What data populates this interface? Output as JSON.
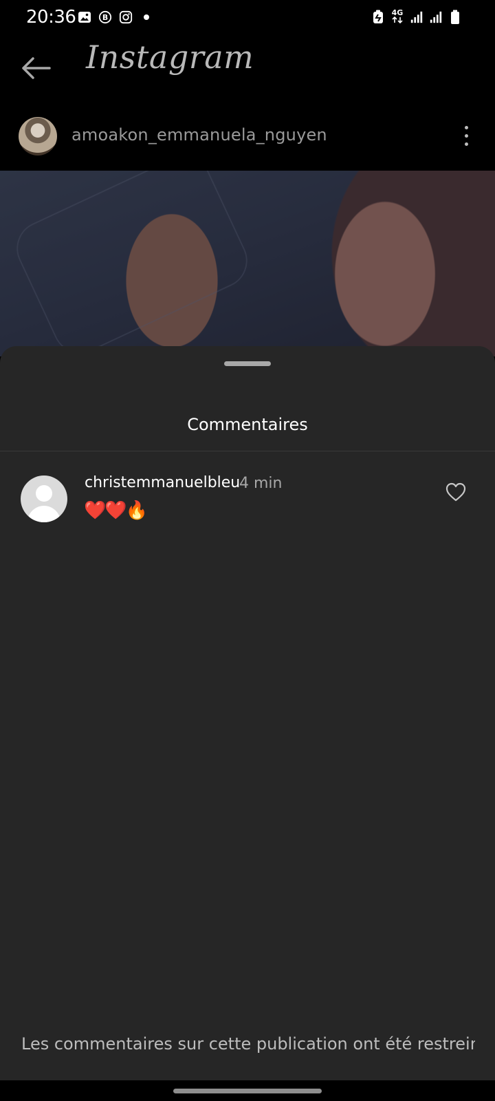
{
  "status_bar": {
    "time": "20:36",
    "left_icons": [
      "gallery-icon",
      "bedtime-b-icon",
      "instagram-icon",
      "dot-icon"
    ],
    "network_label": "4G",
    "right_icons": [
      "battery-saver-icon",
      "data-arrows-icon",
      "signal-1-icon",
      "signal-2-icon",
      "battery-icon"
    ]
  },
  "header": {
    "back_icon": "arrow-left-icon",
    "app_name": "Instagram"
  },
  "post": {
    "author": "amoakon_emmanuela_nguyen",
    "more_icon": "vertical-dots-icon"
  },
  "comments_sheet": {
    "title": "Commentaires",
    "comments": [
      {
        "username": "christemmanuelbleu",
        "time": "4 min",
        "text": "❤️❤️🔥",
        "like_icon": "heart-outline-icon"
      }
    ],
    "restricted_note": "Les commentaires sur cette publication ont été restreints"
  },
  "colors": {
    "sheet_bg": "#262626",
    "app_bg": "#000000",
    "muted_text": "#a8a8a8"
  }
}
